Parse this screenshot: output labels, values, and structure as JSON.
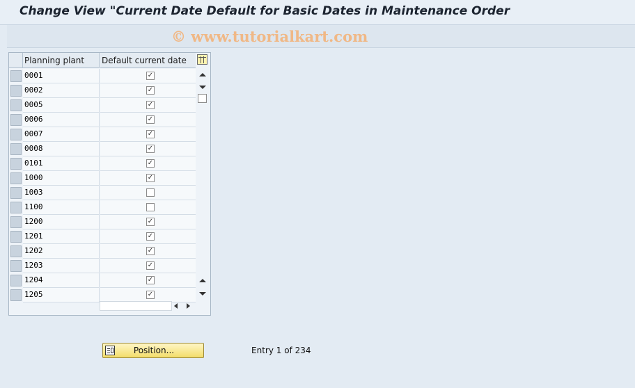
{
  "window": {
    "title": "Change View \"Current Date Default for Basic Dates in Maintenance Order"
  },
  "watermark": "© www.tutorialkart.com",
  "table": {
    "columns": [
      "Planning plant",
      "Default current date"
    ],
    "rows": [
      {
        "plant": "0001",
        "default_current_date": true
      },
      {
        "plant": "0002",
        "default_current_date": true
      },
      {
        "plant": "0005",
        "default_current_date": true
      },
      {
        "plant": "0006",
        "default_current_date": true
      },
      {
        "plant": "0007",
        "default_current_date": true
      },
      {
        "plant": "0008",
        "default_current_date": true
      },
      {
        "plant": "0101",
        "default_current_date": true
      },
      {
        "plant": "1000",
        "default_current_date": true
      },
      {
        "plant": "1003",
        "default_current_date": false
      },
      {
        "plant": "1100",
        "default_current_date": false
      },
      {
        "plant": "1200",
        "default_current_date": true
      },
      {
        "plant": "1201",
        "default_current_date": true
      },
      {
        "plant": "1202",
        "default_current_date": true
      },
      {
        "plant": "1203",
        "default_current_date": true
      },
      {
        "plant": "1204",
        "default_current_date": true
      },
      {
        "plant": "1205",
        "default_current_date": true
      }
    ]
  },
  "footer": {
    "position_button_label": "Position...",
    "entry_text": "Entry 1 of 234"
  },
  "icons": {
    "table_settings": "table-settings-icon",
    "position": "position-icon",
    "scroll_up": "scroll-up-icon",
    "scroll_down": "scroll-down-icon"
  }
}
